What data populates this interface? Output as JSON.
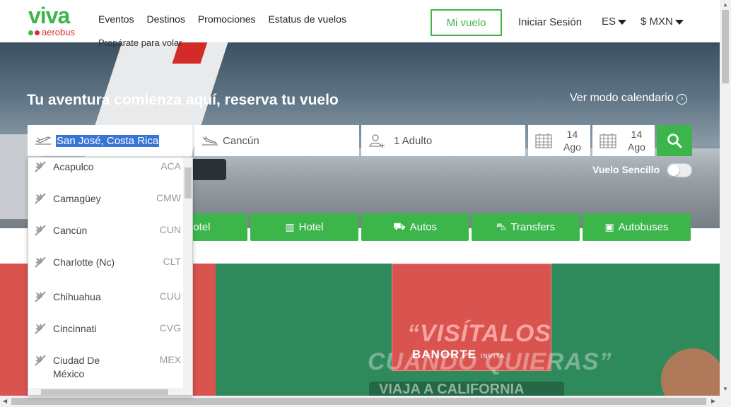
{
  "header": {
    "brand_top": "viva",
    "brand_bottom": "aerobus",
    "nav": [
      "Eventos",
      "Destinos",
      "Promociones",
      "Estatus de vuelos"
    ],
    "nav_second_row": "Prepárate para volar",
    "mi_vuelo": "Mi vuelo",
    "login": "Iniciar Sesión",
    "language": "ES",
    "currency": "$ MXN"
  },
  "hero": {
    "title": "Tu aventura comienza aquí, reserva tu vuelo",
    "calendar_link": "Ver modo calendario"
  },
  "search": {
    "origin_value": "San José, Costa Rica",
    "destination_value": "Cancún",
    "passengers_value": "1 Adulto",
    "depart_day": "14",
    "depart_month": "Ago",
    "return_day": "14",
    "return_month": "Ago",
    "one_way_label": "Vuelo Sencillo",
    "one_way_on": false
  },
  "tabs": [
    "+ Hotel",
    "Hotel",
    "Autos",
    "Transfers",
    "Autobuses"
  ],
  "dropdown": {
    "items": [
      {
        "name": "Acapulco",
        "code": "ACA"
      },
      {
        "name": "Camagüey",
        "code": "CMW"
      },
      {
        "name": "Cancún",
        "code": "CUN"
      },
      {
        "name": "Charlotte (Nc)",
        "code": "CLT"
      },
      {
        "name": "Chihuahua",
        "code": "CUU"
      },
      {
        "name": "Cincinnati",
        "code": "CVG"
      },
      {
        "name": "Ciudad De México",
        "code": "MEX"
      }
    ]
  },
  "promo": {
    "line1": "“VISÍTALOS",
    "line2": "CUANDO QUIERAS”",
    "line3": "VIAJA A CALIFORNIA",
    "sponsor": "BANORTE",
    "sponsor_tag": "INVITA"
  },
  "colors": {
    "brand_green": "#3cb54a",
    "brand_red": "#e02a2a",
    "selection_blue": "#3875d7"
  }
}
